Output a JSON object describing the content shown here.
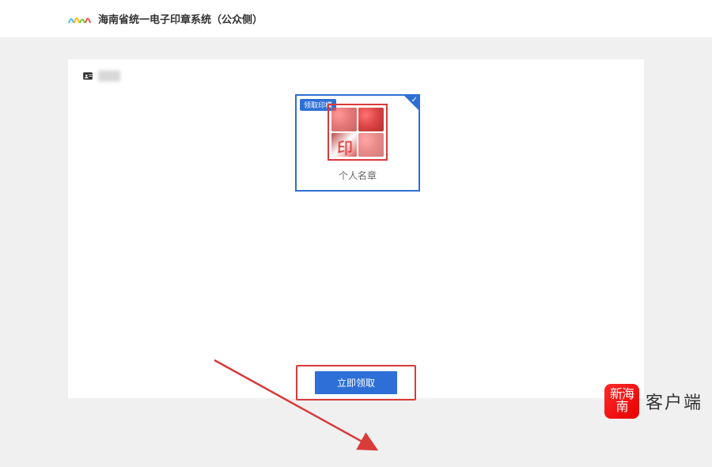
{
  "header": {
    "title": "海南省统一电子印章系统（公众侧）"
  },
  "user": {
    "name_placeholder": ""
  },
  "seal_card": {
    "badge": "领取印模",
    "caption": "个人名章",
    "kanji_hint": "印"
  },
  "action": {
    "claim_label": "立即领取"
  },
  "watermark": {
    "logo_text": "新海南",
    "label": "客户端"
  },
  "colors": {
    "accent_blue": "#2d6fd6",
    "accent_red": "#d93a3a"
  }
}
